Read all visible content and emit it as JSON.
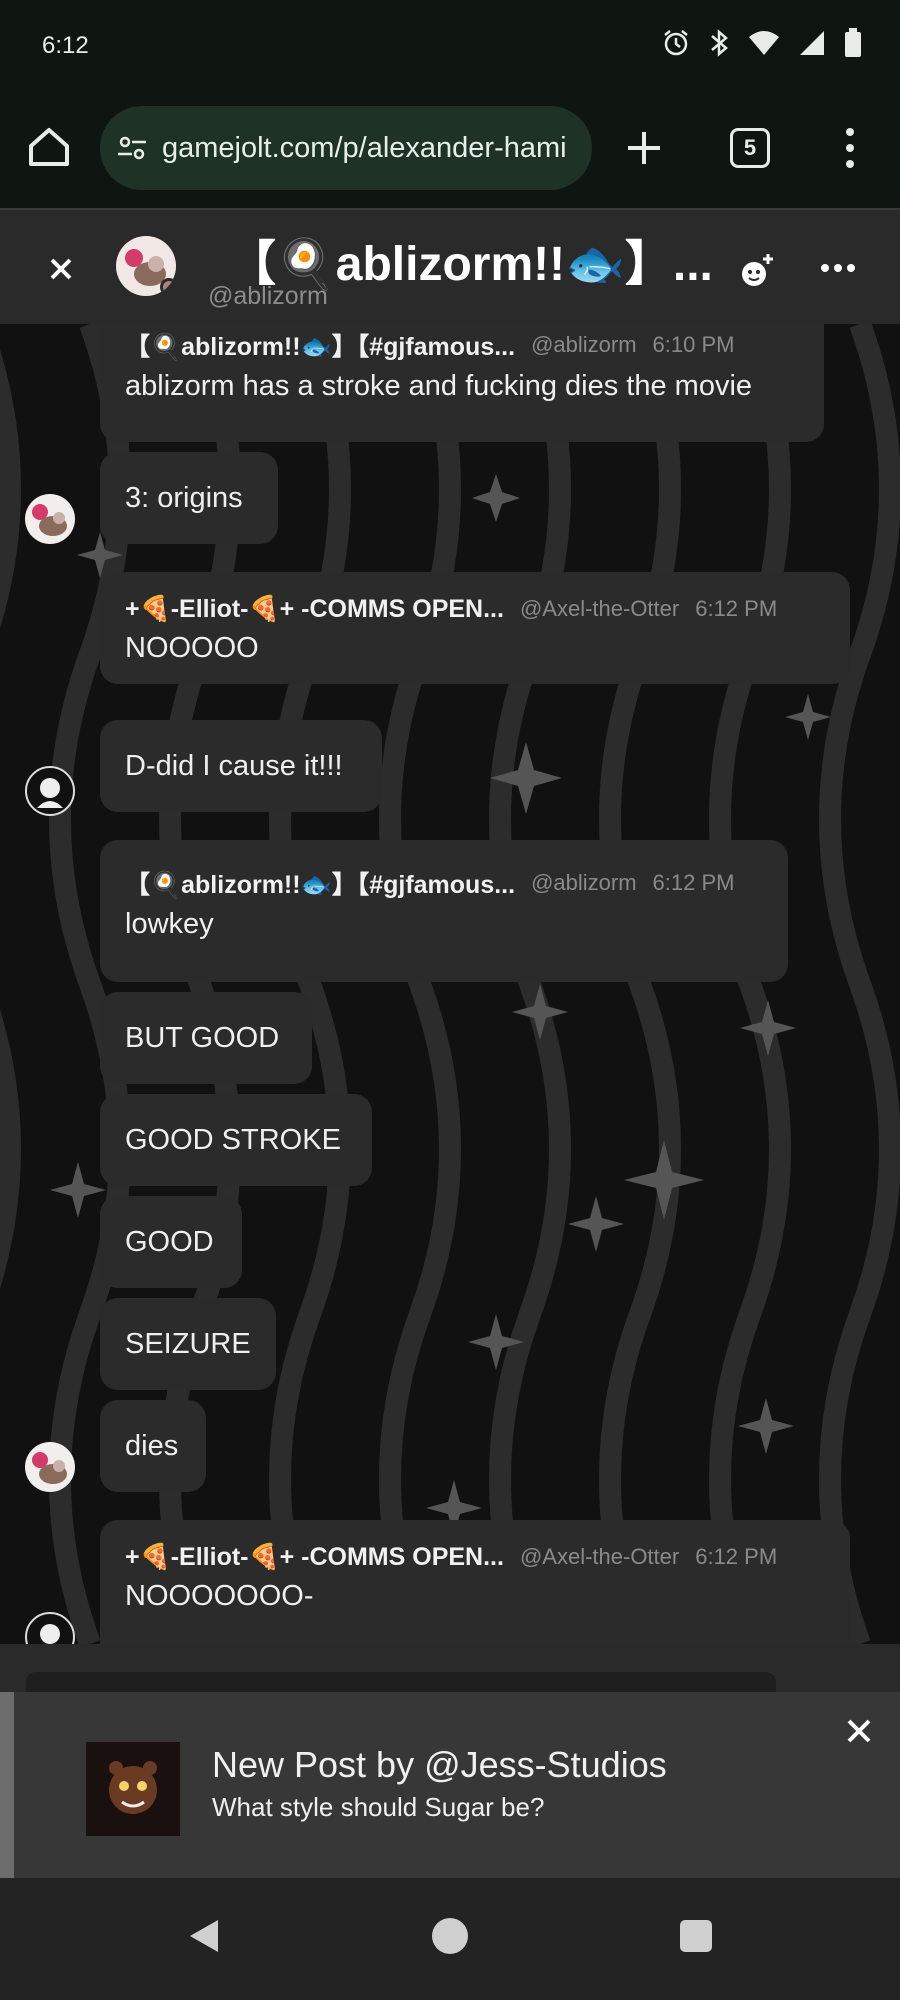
{
  "status_bar": {
    "time": "6:12",
    "icons": [
      "alarm-icon",
      "bluetooth-icon",
      "wifi-icon",
      "signal-icon",
      "battery-icon"
    ]
  },
  "browser": {
    "url": "gamejolt.com/p/alexander-hami",
    "tab_count": "5"
  },
  "chat_header": {
    "title": "【🍳ablizorm!!🐟】...",
    "handle": "@ablizorm"
  },
  "messages": [
    {
      "author": "【🍳ablizorm!!🐟】【#gjfamous...",
      "handle": "@ablizorm",
      "time": "6:10 PM",
      "text": "ablizorm has a stroke and fucking dies the movie"
    },
    {
      "text": "3: origins"
    },
    {
      "author": "+🍕-Elliot-🍕+ -COMMS OPEN...",
      "handle": "@Axel-the-Otter",
      "time": "6:12 PM",
      "text": "NOOOOO"
    },
    {
      "text": "D-did I cause it!!!"
    },
    {
      "author": "【🍳ablizorm!!🐟】【#gjfamous...",
      "handle": "@ablizorm",
      "time": "6:12 PM",
      "text": "lowkey"
    },
    {
      "text": "BUT GOOD"
    },
    {
      "text": "GOOD STROKE"
    },
    {
      "text": "GOOD"
    },
    {
      "text": "SEIZURE"
    },
    {
      "text": "dies"
    },
    {
      "author": "+🍕-Elliot-🍕+ -COMMS OPEN...",
      "handle": "@Axel-the-Otter",
      "time": "6:12 PM",
      "text": "NOOOOOOO-"
    }
  ],
  "notification": {
    "title": "New Post by @Jess-Studios",
    "body": "What style should Sugar be?"
  },
  "colors": {
    "chrome_bg": "#0f1611",
    "url_bg": "#1e3326",
    "header_bg": "#2a2a2a",
    "bubble_bg": "#2b2b2b",
    "notification_bg": "#373737"
  }
}
